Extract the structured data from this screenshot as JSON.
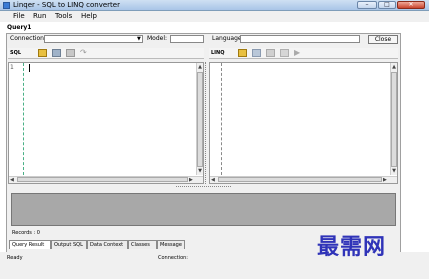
{
  "window": {
    "title": "Linqer - SQL to LINQ converter",
    "controls": [
      "–",
      "□",
      "✕"
    ]
  },
  "menu": [
    "File",
    "Run",
    "Tools",
    "Help"
  ],
  "query_tab": "Query1",
  "connection": {
    "label": "Connection:",
    "value": ""
  },
  "model": {
    "label": "Model:",
    "value": ""
  },
  "language": {
    "label": "Language:",
    "value": ""
  },
  "close_button": "Close",
  "sql_panel": {
    "label": "SQL",
    "line_number": "1"
  },
  "linq_panel": {
    "label": "LINQ"
  },
  "records": "Records : 0",
  "bottom_tabs": [
    "Query Result",
    "Output SQL",
    "Data Context",
    "Classes",
    "Message"
  ],
  "status": {
    "left": "Ready",
    "right": "Connection:"
  },
  "watermark": "最需网",
  "colors": {
    "title_gradient_top": "#cfe0f3",
    "results_bg": "#a8a8a8",
    "watermark": "#2f33b8"
  }
}
